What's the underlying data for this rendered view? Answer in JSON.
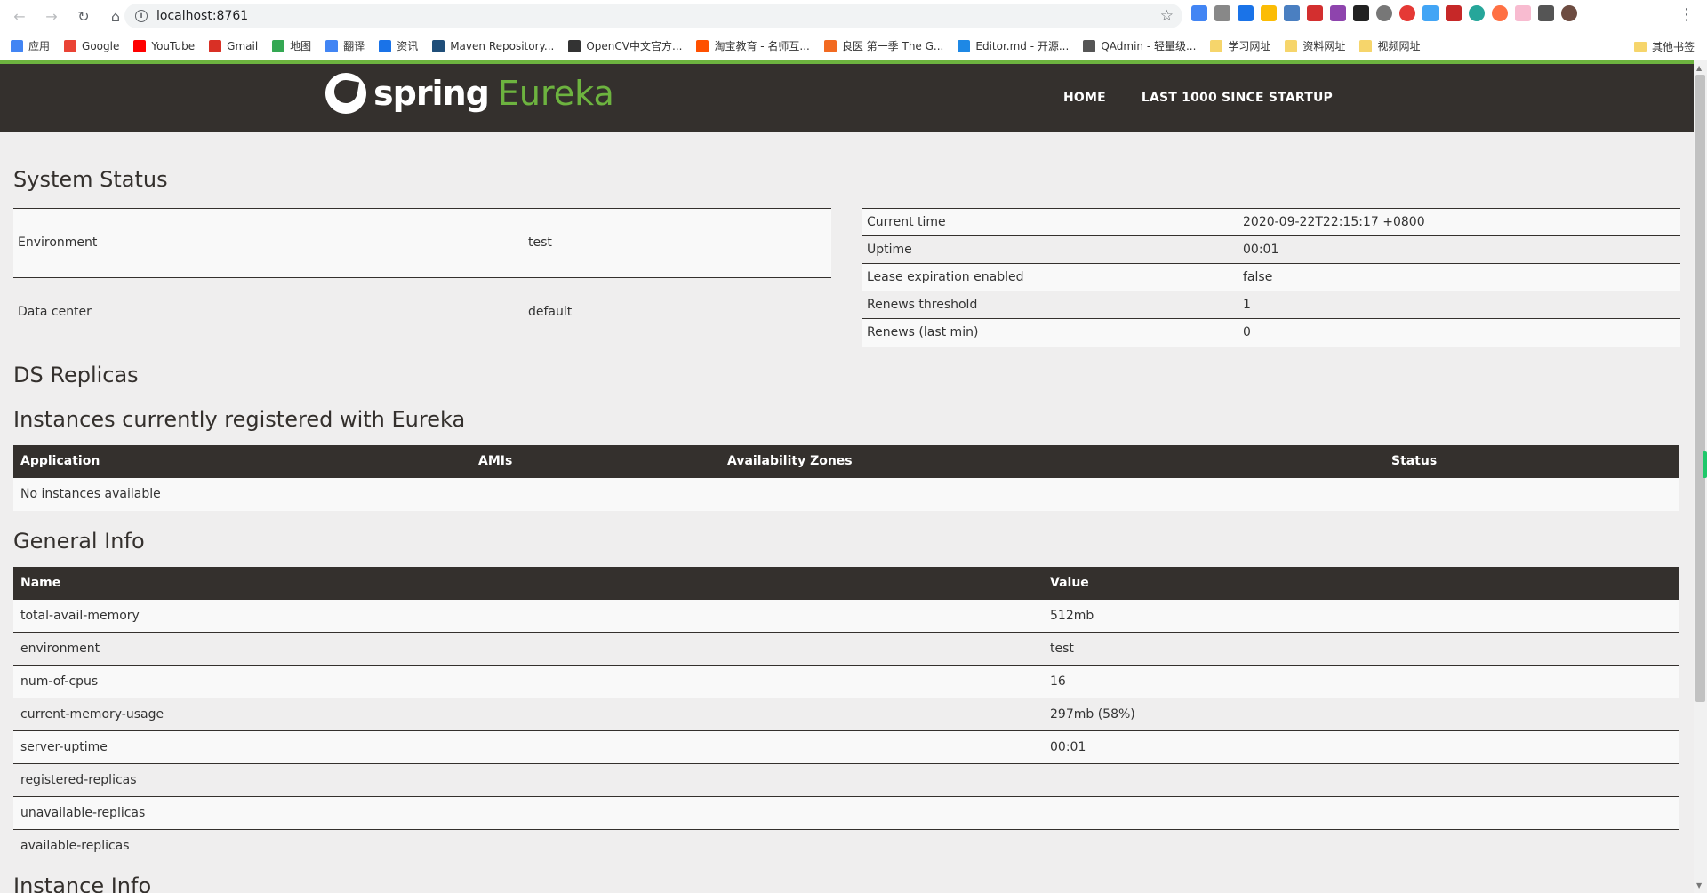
{
  "browser": {
    "url": "localhost:8761",
    "bookmarks": [
      {
        "label": "应用",
        "color": "#4285f4"
      },
      {
        "label": "Google",
        "color": "#ea4335"
      },
      {
        "label": "YouTube",
        "color": "#ff0000"
      },
      {
        "label": "Gmail",
        "color": "#d93025"
      },
      {
        "label": "地图",
        "color": "#34a853"
      },
      {
        "label": "翻译",
        "color": "#4285f4"
      },
      {
        "label": "资讯",
        "color": "#1a73e8"
      },
      {
        "label": "Maven Repository...",
        "color": "#1f4e79"
      },
      {
        "label": "OpenCV中文官方...",
        "color": "#333333"
      },
      {
        "label": "淘宝教育 - 名师互...",
        "color": "#ff5000"
      },
      {
        "label": "良医 第一季 The G...",
        "color": "#f26a21"
      },
      {
        "label": "Editor.md - 开源...",
        "color": "#1e88e5"
      },
      {
        "label": "QAdmin - 轻量级...",
        "color": "#555555"
      },
      {
        "label": "学习网址",
        "color": "#f6d56b"
      },
      {
        "label": "资料网址",
        "color": "#f6d56b"
      },
      {
        "label": "视频网址",
        "color": "#f6d56b"
      }
    ],
    "other_bookmarks": "其他书签"
  },
  "header": {
    "logo_spring": "spring",
    "logo_eureka": "Eureka",
    "nav": [
      "HOME",
      "LAST 1000 SINCE STARTUP"
    ]
  },
  "system_status": {
    "title": "System Status",
    "left": [
      {
        "key": "Environment",
        "value": "test"
      },
      {
        "key": "Data center",
        "value": "default"
      }
    ],
    "right": [
      {
        "key": "Current time",
        "value": "2020-09-22T22:15:17 +0800"
      },
      {
        "key": "Uptime",
        "value": "00:01"
      },
      {
        "key": "Lease expiration enabled",
        "value": "false"
      },
      {
        "key": "Renews threshold",
        "value": "1"
      },
      {
        "key": "Renews (last min)",
        "value": "0"
      }
    ]
  },
  "ds_replicas": {
    "title": "DS Replicas"
  },
  "instances": {
    "title": "Instances currently registered with Eureka",
    "headers": [
      "Application",
      "AMIs",
      "Availability Zones",
      "Status"
    ],
    "empty_text": "No instances available"
  },
  "general_info": {
    "title": "General Info",
    "headers": [
      "Name",
      "Value"
    ],
    "rows": [
      {
        "name": "total-avail-memory",
        "value": "512mb"
      },
      {
        "name": "environment",
        "value": "test"
      },
      {
        "name": "num-of-cpus",
        "value": "16"
      },
      {
        "name": "current-memory-usage",
        "value": "297mb (58%)"
      },
      {
        "name": "server-uptime",
        "value": "00:01"
      },
      {
        "name": "registered-replicas",
        "value": ""
      },
      {
        "name": "unavailable-replicas",
        "value": ""
      },
      {
        "name": "available-replicas",
        "value": ""
      }
    ]
  },
  "next_section_title": "Instance Info"
}
